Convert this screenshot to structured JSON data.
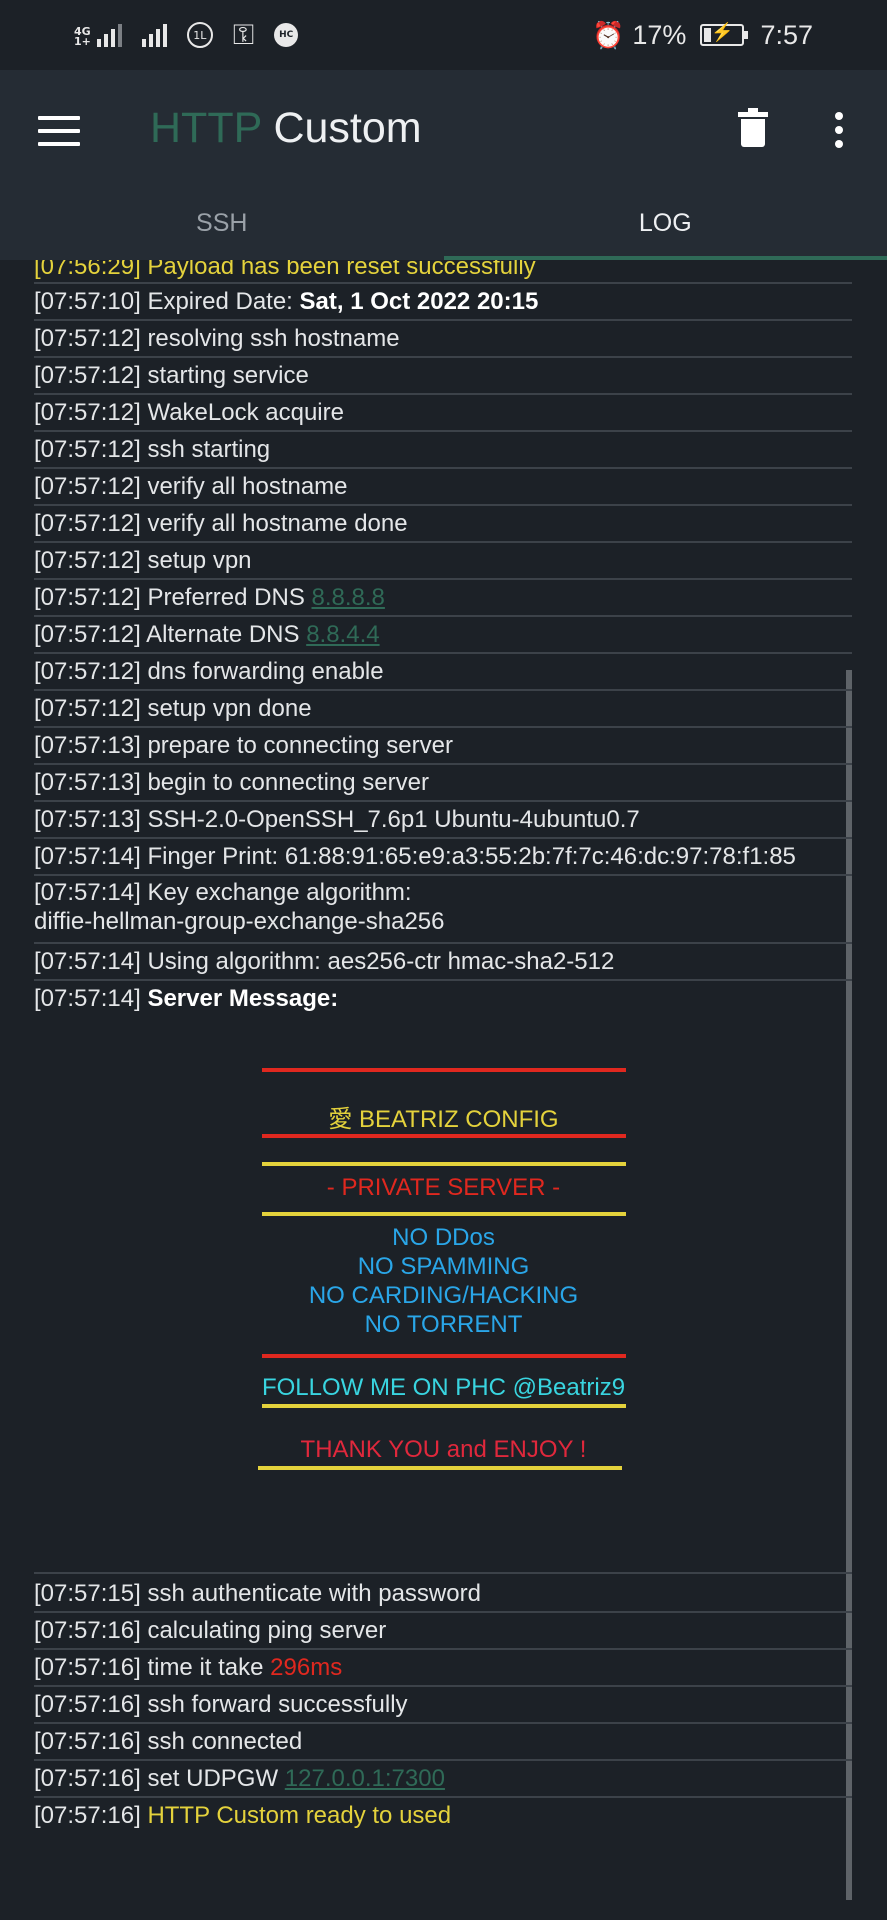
{
  "status_bar": {
    "network_type": "4G",
    "network_sub": "1+",
    "vpn_badge": "1L",
    "hc_badge": "HC",
    "battery": "17%",
    "battery_level": 0.17,
    "time": "7:57"
  },
  "app_bar": {
    "title_part1": "HTTP",
    "title_part2": "Custom"
  },
  "tabs": [
    {
      "label": "SSH",
      "active": false
    },
    {
      "label": "LOG",
      "active": true
    }
  ],
  "log": {
    "partial_top": "[07:56:29] Payload has been reset successfully",
    "lines": [
      {
        "ts": "[07:57:10]",
        "text": "Expired Date:",
        "extra": "Sat, 1 Oct 2022 20:15"
      },
      {
        "ts": "[07:57:12]",
        "text": "resolving ssh hostname"
      },
      {
        "ts": "[07:57:12]",
        "text": "starting service"
      },
      {
        "ts": "[07:57:12]",
        "text": "WakeLock acquire"
      },
      {
        "ts": "[07:57:12]",
        "text": "ssh starting"
      },
      {
        "ts": "[07:57:12]",
        "text": "verify all hostname"
      },
      {
        "ts": "[07:57:12]",
        "text": "verify all hostname done"
      },
      {
        "ts": "[07:57:12]",
        "text": "setup vpn"
      },
      {
        "ts": "[07:57:12]",
        "text": "Preferred DNS",
        "link": "8.8.8.8"
      },
      {
        "ts": "[07:57:12]",
        "text": "Alternate DNS",
        "link": "8.8.4.4"
      },
      {
        "ts": "[07:57:12]",
        "text": "dns forwarding enable"
      },
      {
        "ts": "[07:57:12]",
        "text": "setup vpn done"
      },
      {
        "ts": "[07:57:13]",
        "text": "prepare to connecting server"
      },
      {
        "ts": "[07:57:13]",
        "text": "begin to connecting server"
      },
      {
        "ts": "[07:57:13]",
        "text": "SSH-2.0-OpenSSH_7.6p1 Ubuntu-4ubuntu0.7"
      },
      {
        "ts": "[07:57:14]",
        "text": "Finger Print: 61:88:91:65:e9:a3:55:2b:7f:7c:46:dc:97:78:f1:85"
      },
      {
        "ts": "[07:57:14]",
        "text": "Key exchange algorithm:",
        "line2": "diffie-hellman-group-exchange-sha256"
      },
      {
        "ts": "[07:57:14]",
        "text": "Using algorithm: aes256-ctr hmac-sha2-512"
      },
      {
        "ts": "[07:57:14]",
        "extra": "Server Message:"
      }
    ],
    "server_message": {
      "title": "愛 BEATRIZ CONFIG",
      "private": "- PRIVATE SERVER -",
      "rules": [
        "NO DDos",
        "NO SPAMMING",
        "NO CARDING/HACKING",
        "NO TORRENT"
      ],
      "follow": "FOLLOW ME ON PHC @Beatriz9",
      "thanks": "THANK YOU and ENJOY !",
      "colors": {
        "red_rule": "#e0281f",
        "yellow_rule": "#e4d23c",
        "title": "#e4d23c",
        "private": "#e0281f",
        "rules": "#2aa6e8",
        "follow": "#39d5e0",
        "thanks": "#e0283c"
      }
    },
    "after_lines": [
      {
        "ts": "[07:57:15]",
        "text": "ssh authenticate with password"
      },
      {
        "ts": "[07:57:16]",
        "text": "calculating ping server"
      },
      {
        "ts": "[07:57:16]",
        "text": "time it take",
        "red": "296ms"
      },
      {
        "ts": "[07:57:16]",
        "text": "ssh forward successfully"
      },
      {
        "ts": "[07:57:16]",
        "text": "ssh connected"
      },
      {
        "ts": "[07:57:16]",
        "text": "set UDPGW",
        "link": "127.0.0.1:7300"
      },
      {
        "ts": "[07:57:16]",
        "yellow": "HTTP Custom ready to used"
      }
    ]
  },
  "icons": [
    "signal-icon",
    "vpn-key-icon",
    "alarm-icon",
    "battery-icon",
    "menu-icon",
    "trash-icon",
    "more-vert-icon"
  ]
}
